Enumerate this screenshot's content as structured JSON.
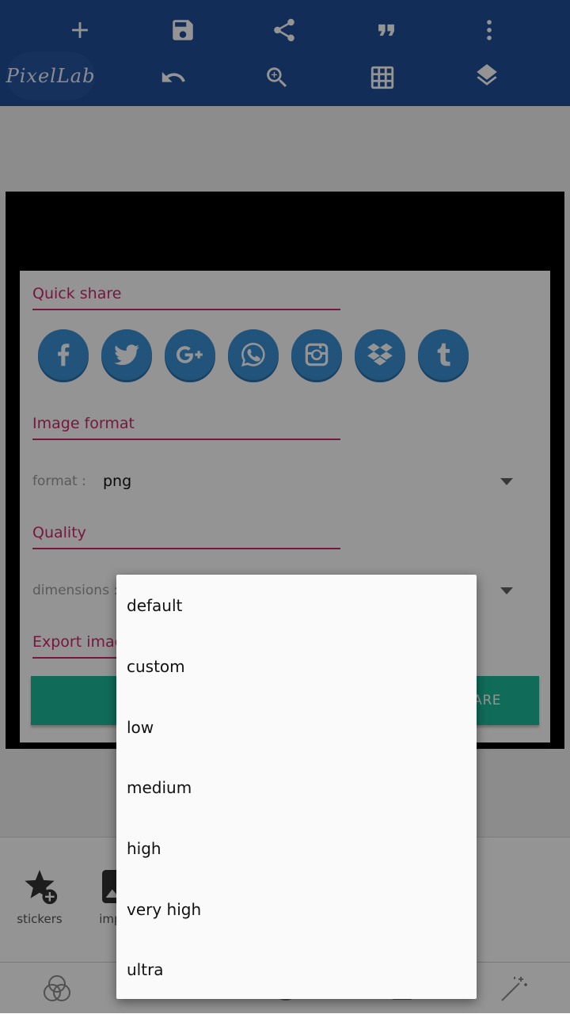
{
  "toolbar": {
    "logo_text": "PixelLab",
    "icons": [
      "add-icon",
      "save-icon",
      "share-icon",
      "quote-icon",
      "more-vert-icon",
      "undo-icon",
      "zoom-in-icon",
      "grid-icon",
      "layers-icon"
    ]
  },
  "dialog": {
    "quick_share_title": "Quick share",
    "share_targets": [
      "facebook",
      "twitter",
      "google-plus",
      "whatsapp",
      "instagram",
      "dropbox",
      "tumblr"
    ],
    "image_format_title": "Image format",
    "format_label": "format :",
    "format_value": "png",
    "quality_title": "Quality",
    "dimensions_label": "dimensions :",
    "export_title": "Export image",
    "share_button_label": "SHARE"
  },
  "bottom_panel": {
    "tools": [
      {
        "label": "stickers",
        "icon": "star-add-icon"
      },
      {
        "label": "import",
        "icon": "image-icon"
      }
    ]
  },
  "bottom_nav": {
    "icons": [
      "blend-icon",
      "text-icon",
      "emoji-icon",
      "shape-icon",
      "effects-wand-icon"
    ]
  },
  "dropdown": {
    "options": [
      "default",
      "custom",
      "low",
      "medium",
      "high",
      "very high",
      "ultra"
    ]
  },
  "colors": {
    "toolbar": "#1f4e96",
    "accent_pink": "#cc2a6b",
    "share_blue": "#3a8fd4",
    "share_green": "#1dbb9a"
  }
}
